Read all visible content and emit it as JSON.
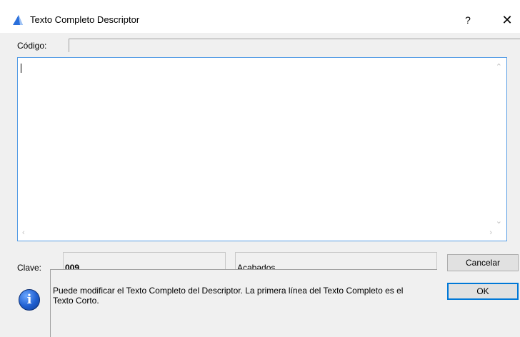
{
  "window": {
    "title": "Texto Completo Descriptor",
    "help_label": "?",
    "close_label": "✕"
  },
  "codigo": {
    "label": "Código:",
    "value": ""
  },
  "editor": {
    "value": ""
  },
  "clave": {
    "label": "Clave:",
    "code": "009",
    "name": "Acabados"
  },
  "message": {
    "text": "Puede modificar el Texto Completo del Descriptor. La primera línea del Texto Completo es el Texto Corto."
  },
  "buttons": {
    "cancel": "Cancelar",
    "ok": "OK"
  },
  "colors": {
    "accent": "#0078d7",
    "focus_border": "#569de5",
    "info": "#1f5fd0"
  }
}
